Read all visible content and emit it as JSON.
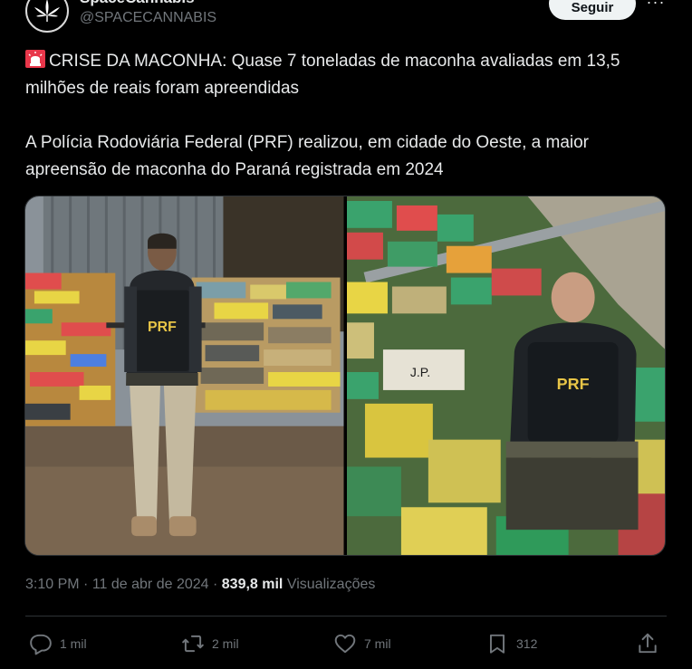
{
  "author": {
    "display_name": "SpaceCannabis",
    "handle": "@SPACECANNABIS"
  },
  "follow_label": "Seguir",
  "more_label": "···",
  "tweet": {
    "line1": "CRISE DA MACONHA: Quase 7 toneladas de maconha avaliadas em 13,5 milhões de reais foram apreendidas",
    "line2": "A Polícia Rodoviária Federal (PRF) realizou, em cidade do Oeste, a maior apreensão de maconha do Paraná registrada em 2024"
  },
  "media": {
    "left_vest_label": "PRF",
    "right_vest_label": "PRF"
  },
  "meta": {
    "time": "3:10 PM",
    "separator": "·",
    "date": "11 de abr de 2024",
    "views_count": "839,8 mil",
    "views_label": "Visualizações"
  },
  "actions": {
    "reply_count": "1 mil",
    "repost_count": "2 mil",
    "like_count": "7 mil",
    "bookmark_count": "312"
  },
  "icons": {
    "emoji": "siren-icon",
    "reply": "reply-icon",
    "repost": "repost-icon",
    "like": "heart-icon",
    "bookmark": "bookmark-icon",
    "share": "share-icon"
  },
  "colors": {
    "background": "#000000",
    "text": "#e7e9ea",
    "muted": "#71767b",
    "follow_bg": "#eff3f4"
  }
}
